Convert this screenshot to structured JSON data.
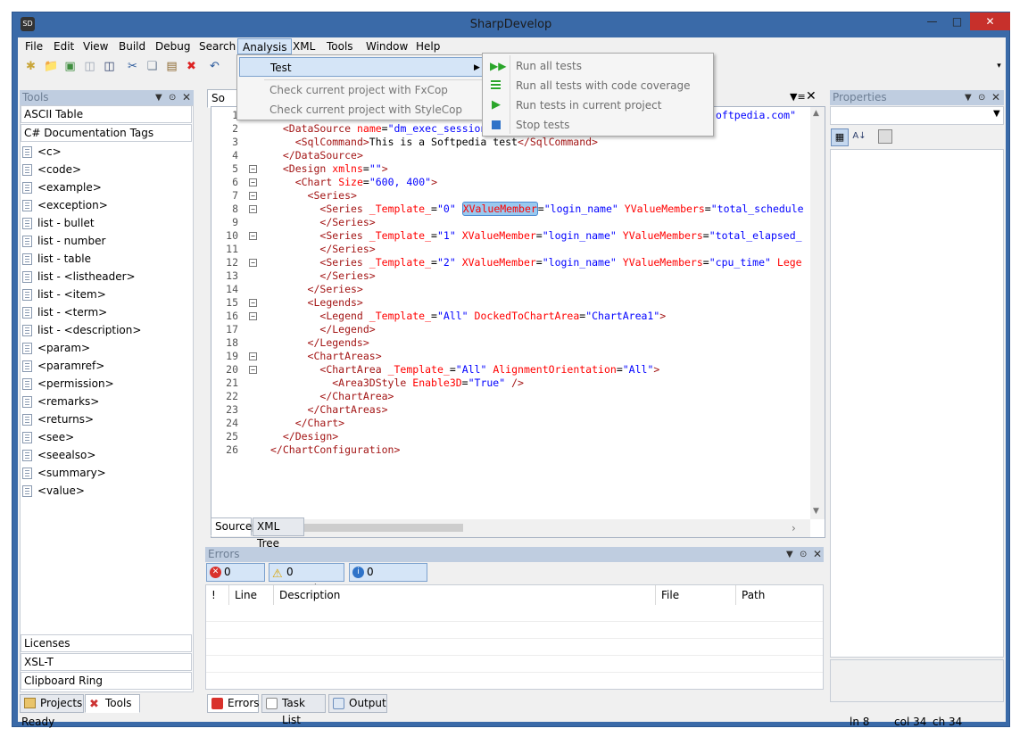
{
  "window": {
    "title": "SharpDevelop"
  },
  "menu": [
    "File",
    "Edit",
    "View",
    "Build",
    "Debug",
    "Search",
    "Analysis",
    "XML",
    "Tools",
    "Window",
    "Help"
  ],
  "tools_panel": {
    "title": "Tools",
    "categories_top": [
      "ASCII Table",
      "C# Documentation Tags"
    ],
    "items": [
      "<c>",
      "<code>",
      "<example>",
      "<exception>",
      "list - bullet",
      "list - number",
      "list - table",
      "list - <listheader>",
      "list - <item>",
      "list - <term>",
      "list - <description>",
      "<param>",
      "<paramref>",
      "<permission>",
      "<remarks>",
      "<returns>",
      "<see>",
      "<seealso>",
      "<summary>",
      "<value>"
    ],
    "categories_bottom": [
      "Licenses",
      "XSL-T",
      "Clipboard Ring"
    ],
    "tabs": [
      "Projects",
      "Tools"
    ]
  },
  "editor": {
    "tab_label": "So",
    "bottom_tabs": [
      "Source",
      "XML Tree"
    ],
    "lines": [
      {
        "n": "1",
        "html": ""
      },
      {
        "n": "2",
        "html": "  <span class='t'>&lt;DataSource</span> <span class='at'>name</span>=<span class='av'>\"dm_exec_session</span>"
      },
      {
        "n": "3",
        "html": "    <span class='t'>&lt;SqlCommand&gt;</span>This is a Softpedia test<span class='t'>&lt;/SqlCommand&gt;</span>"
      },
      {
        "n": "4",
        "html": "  <span class='t'>&lt;/DataSource&gt;</span>"
      },
      {
        "n": "5",
        "html": "  <span class='t'>&lt;Design</span> <span class='at'>xmlns</span>=<span class='av'>\"\"</span><span class='t'>&gt;</span>"
      },
      {
        "n": "6",
        "html": "    <span class='t'>&lt;Chart</span> <span class='at'>Size</span>=<span class='av'>\"600, 400\"</span><span class='t'>&gt;</span>"
      },
      {
        "n": "7",
        "html": "      <span class='t'>&lt;Series&gt;</span>"
      },
      {
        "n": "8",
        "html": "        <span class='t'>&lt;Series</span> <span class='at'>_Template_</span>=<span class='av'>\"0\"</span> <span class='at hl'>XValueMember</span>=<span class='av'>\"login_name\"</span> <span class='at'>YValueMembers</span>=<span class='av'>\"total_schedule</span>"
      },
      {
        "n": "9",
        "html": "        <span class='t'>&lt;/Series&gt;</span>"
      },
      {
        "n": "10",
        "html": "        <span class='t'>&lt;Series</span> <span class='at'>_Template_</span>=<span class='av'>\"1\"</span> <span class='at'>XValueMember</span>=<span class='av'>\"login_name\"</span> <span class='at'>YValueMembers</span>=<span class='av'>\"total_elapsed_</span>"
      },
      {
        "n": "11",
        "html": "        <span class='t'>&lt;/Series&gt;</span>"
      },
      {
        "n": "12",
        "html": "        <span class='t'>&lt;Series</span> <span class='at'>_Template_</span>=<span class='av'>\"2\"</span> <span class='at'>XValueMember</span>=<span class='av'>\"login_name\"</span> <span class='at'>YValueMembers</span>=<span class='av'>\"cpu_time\"</span> <span class='at'>Lege</span>"
      },
      {
        "n": "13",
        "html": "        <span class='t'>&lt;/Series&gt;</span>"
      },
      {
        "n": "14",
        "html": "      <span class='t'>&lt;/Series&gt;</span>"
      },
      {
        "n": "15",
        "html": "      <span class='t'>&lt;Legends&gt;</span>"
      },
      {
        "n": "16",
        "html": "        <span class='t'>&lt;Legend</span> <span class='at'>_Template_</span>=<span class='av'>\"All\"</span> <span class='at'>DockedToChartArea</span>=<span class='av'>\"ChartArea1\"</span><span class='t'>&gt;</span>"
      },
      {
        "n": "17",
        "html": "        <span class='t'>&lt;/Legend&gt;</span>"
      },
      {
        "n": "18",
        "html": "      <span class='t'>&lt;/Legends&gt;</span>"
      },
      {
        "n": "19",
        "html": "      <span class='t'>&lt;ChartAreas&gt;</span>"
      },
      {
        "n": "20",
        "html": "        <span class='t'>&lt;ChartArea</span> <span class='at'>_Template_</span>=<span class='av'>\"All\"</span> <span class='at'>AlignmentOrientation</span>=<span class='av'>\"All\"</span><span class='t'>&gt;</span>"
      },
      {
        "n": "21",
        "html": "          <span class='t'>&lt;Area3DStyle</span> <span class='at'>Enable3D</span>=<span class='av'>\"True\"</span> <span class='t'>/&gt;</span>"
      },
      {
        "n": "22",
        "html": "        <span class='t'>&lt;/ChartArea&gt;</span>"
      },
      {
        "n": "23",
        "html": "      <span class='t'>&lt;/ChartAreas&gt;</span>"
      },
      {
        "n": "24",
        "html": "    <span class='t'>&lt;/Chart&gt;</span>"
      },
      {
        "n": "25",
        "html": "  <span class='t'>&lt;/Design&gt;</span>"
      },
      {
        "n": "26",
        "html": "<span class='t'>&lt;/ChartConfiguration&gt;</span>"
      }
    ],
    "line1_tail": "oftpedia.com\""
  },
  "analysis_menu": {
    "items": [
      "Test",
      "Check current project with FxCop",
      "Check current project with StyleCop"
    ]
  },
  "test_submenu": {
    "items": [
      "Run all tests",
      "Run all tests with code coverage",
      "Run tests in current project",
      "Stop tests"
    ]
  },
  "properties_panel": {
    "title": "Properties"
  },
  "errors_panel": {
    "title": "Errors",
    "filters": [
      "0 Errors",
      "0 Warnings",
      "0 Messages"
    ],
    "columns": [
      "!",
      "Line",
      "Description",
      "File",
      "Path"
    ],
    "tabs": [
      "Errors",
      "Task List",
      "Output"
    ]
  },
  "status": {
    "left": "Ready",
    "ln": "ln 8",
    "col": "col 34",
    "ch": "ch 34"
  },
  "colors": {
    "frame": "#3a6aa8",
    "panel_header": "#bfcde0",
    "highlight": "#99c9ef"
  }
}
